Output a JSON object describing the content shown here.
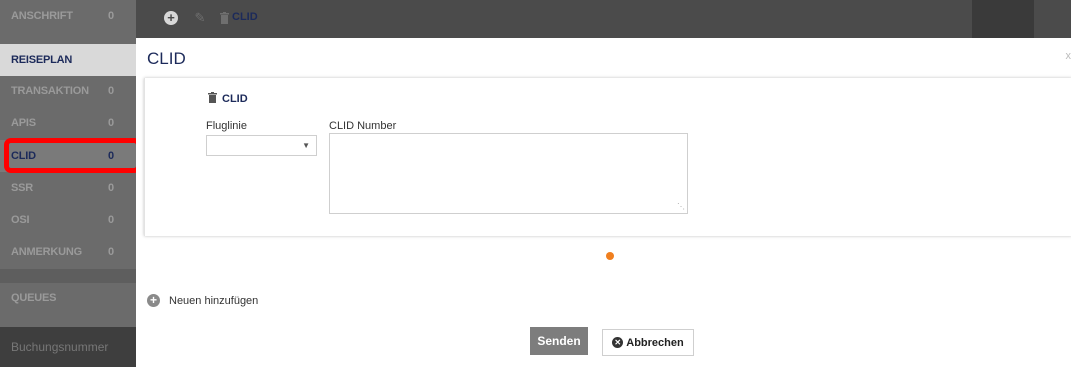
{
  "sidebar": {
    "items": [
      {
        "label": "ANSCHRIFT",
        "count": "0"
      },
      {
        "label": "REISEPLAN",
        "count": ""
      },
      {
        "label": "TRANSAKTION",
        "count": "0"
      },
      {
        "label": "APIS",
        "count": "0"
      },
      {
        "label": "CLID",
        "count": "0"
      },
      {
        "label": "SSR",
        "count": "0"
      },
      {
        "label": "OSI",
        "count": "0"
      },
      {
        "label": "ANMERKUNG",
        "count": "0"
      }
    ],
    "queues_label": "QUEUES",
    "booking_label": "Buchungsnummer"
  },
  "toolbar": {
    "add_icon": "plus-circle-icon",
    "edit_icon": "pencil-icon",
    "trash_icon": "trash-icon",
    "title": "CLID"
  },
  "main": {
    "title": "CLID",
    "close": "x",
    "card": {
      "title": "CLID",
      "fluglinie_label": "Fluglinie",
      "fluglinie_value": "",
      "clid_label": "CLID Number",
      "clid_value": ""
    },
    "add_new_label": "Neuen hinzufügen",
    "send_label": "Senden",
    "cancel_label": "Abbrechen"
  },
  "colors": {
    "navy": "#1c2a5a",
    "sidebar": "#6b6b6b",
    "toolbar": "#4b4b4b",
    "spinner": "#f07f1f",
    "highlight": "#ff0000"
  }
}
